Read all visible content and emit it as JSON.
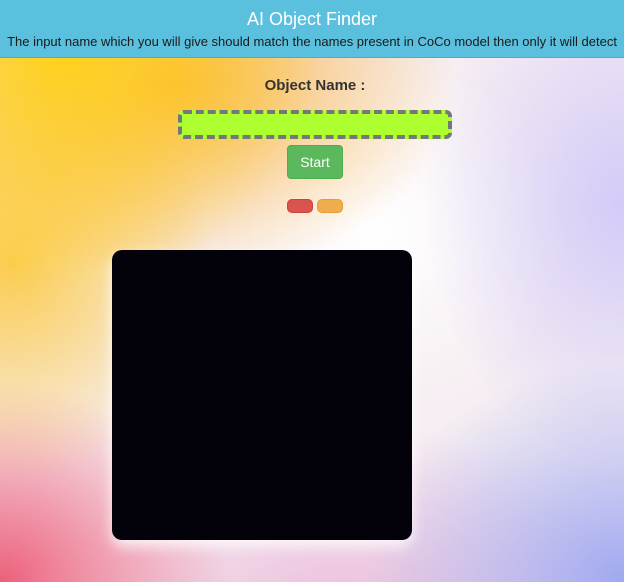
{
  "header": {
    "title": "AI Object Finder",
    "subtitle": "The input name which you will give should match the names present in CoCo model then only it will detect"
  },
  "form": {
    "label": "Object Name :",
    "input_value": "",
    "start_label": "Start"
  },
  "colors": {
    "header_bg": "#5bc0de",
    "input_bg": "#adff2f",
    "start_bg": "#5cb85c",
    "indicator_red": "#d9534f",
    "indicator_orange": "#f0ad4e",
    "video_bg": "#03020a"
  }
}
